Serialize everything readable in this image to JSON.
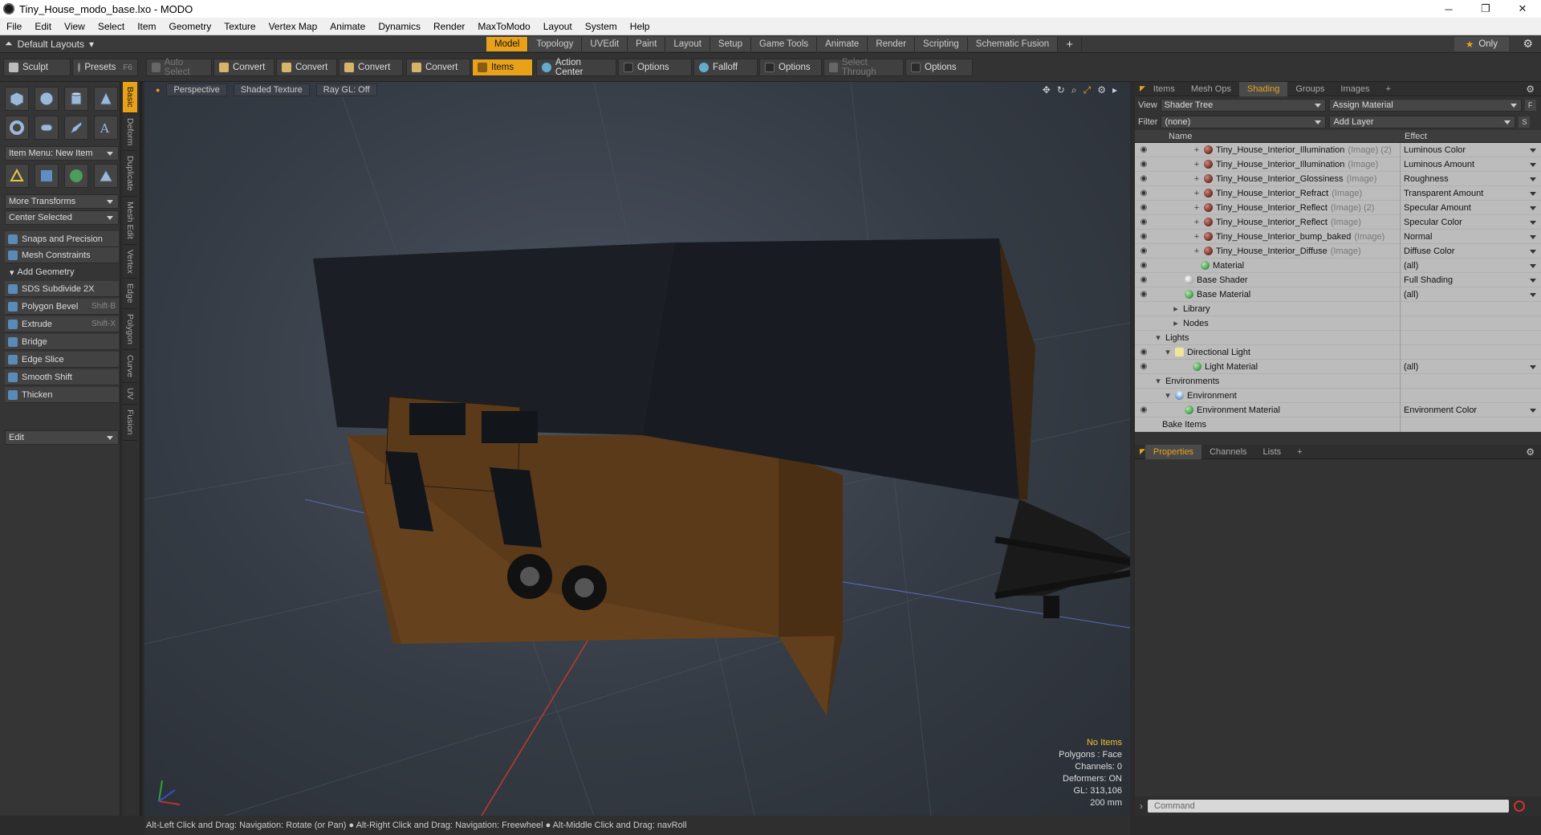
{
  "window": {
    "title": "Tiny_House_modo_base.lxo - MODO",
    "min": "─",
    "max": "❐",
    "close": "✕"
  },
  "menu": [
    "File",
    "Edit",
    "View",
    "Select",
    "Item",
    "Geometry",
    "Texture",
    "Vertex Map",
    "Animate",
    "Dynamics",
    "Render",
    "MaxToModo",
    "Layout",
    "System",
    "Help"
  ],
  "layouts": {
    "label": "Default Layouts"
  },
  "mode_tabs": [
    "Model",
    "Topology",
    "UVEdit",
    "Paint",
    "Layout",
    "Setup",
    "Game Tools",
    "Animate",
    "Render",
    "Scripting",
    "Schematic Fusion"
  ],
  "mode_active": "Model",
  "only_label": "Only",
  "toolbar": {
    "sculpt": "Sculpt",
    "presets": "Presets",
    "presets_key": "F6",
    "auto_select": "Auto Select",
    "convert1": "Convert",
    "convert2": "Convert",
    "convert3": "Convert",
    "convert4": "Convert",
    "items": "Items",
    "action_center": "Action Center",
    "options1": "Options",
    "falloff": "Falloff",
    "options2": "Options",
    "select_through": "Select Through",
    "options3": "Options"
  },
  "left": {
    "item_menu": "Item Menu: New Item",
    "more_transforms": "More Transforms",
    "center_selected": "Center Selected",
    "snaps": "Snaps and Precision",
    "mesh_constraints": "Mesh Constraints",
    "add_geometry": "Add Geometry",
    "tools": [
      {
        "label": "SDS Subdivide 2X",
        "key": ""
      },
      {
        "label": "Polygon Bevel",
        "key": "Shift-B"
      },
      {
        "label": "Extrude",
        "key": "Shift-X"
      },
      {
        "label": "Bridge",
        "key": ""
      },
      {
        "label": "Edge Slice",
        "key": ""
      },
      {
        "label": "Smooth Shift",
        "key": ""
      },
      {
        "label": "Thicken",
        "key": ""
      }
    ],
    "edit": "Edit"
  },
  "vtabs": [
    "Basic",
    "Deform",
    "Duplicate",
    "Mesh Edit",
    "Vertex",
    "Edge",
    "Polygon",
    "Curve",
    "UV",
    "Fusion"
  ],
  "viewport": {
    "perspective": "Perspective",
    "shaded": "Shaded Texture",
    "raygl": "Ray GL: Off",
    "stats": {
      "no_items": "No Items",
      "polygons": "Polygons : Face",
      "channels": "Channels: 0",
      "deformers": "Deformers: ON",
      "gl": "GL: 313,106",
      "size": "200 mm"
    }
  },
  "right": {
    "tabs": [
      "Items",
      "Mesh Ops",
      "Shading",
      "Groups",
      "Images"
    ],
    "active": "Shading",
    "view_label": "View",
    "view_value": "Shader Tree",
    "assign": "Assign Material",
    "filter_label": "Filter",
    "filter_value": "(none)",
    "add_layer": "Add Layer",
    "col_name": "Name",
    "col_effect": "Effect",
    "rows": [
      {
        "name": "Tiny_House_Interior_Illumination",
        "sub": "(Image) (2)",
        "effect": "Luminous Color",
        "kind": "img"
      },
      {
        "name": "Tiny_House_Interior_Illumination",
        "sub": "(Image)",
        "effect": "Luminous Amount",
        "kind": "img"
      },
      {
        "name": "Tiny_House_Interior_Glossiness",
        "sub": "(Image)",
        "effect": "Roughness",
        "kind": "img"
      },
      {
        "name": "Tiny_House_Interior_Refract",
        "sub": "(Image)",
        "effect": "Transparent Amount",
        "kind": "img"
      },
      {
        "name": "Tiny_House_Interior_Reflect",
        "sub": "(Image) (2)",
        "effect": "Specular Amount",
        "kind": "img"
      },
      {
        "name": "Tiny_House_Interior_Reflect",
        "sub": "(Image)",
        "effect": "Specular Color",
        "kind": "img"
      },
      {
        "name": "Tiny_House_Interior_bump_baked",
        "sub": "(Image)",
        "effect": "Normal",
        "kind": "img"
      },
      {
        "name": "Tiny_House_Interior_Diffuse",
        "sub": "(Image)",
        "effect": "Diffuse Color",
        "kind": "img"
      },
      {
        "name": "Material",
        "sub": "",
        "effect": "(all)",
        "kind": "mat"
      },
      {
        "name": "Base Shader",
        "sub": "",
        "effect": "Full Shading",
        "kind": "sh"
      },
      {
        "name": "Base Material",
        "sub": "",
        "effect": "(all)",
        "kind": "mat"
      },
      {
        "name": "Library",
        "sub": "",
        "effect": "",
        "kind": "folder"
      },
      {
        "name": "Nodes",
        "sub": "",
        "effect": "",
        "kind": "folder"
      },
      {
        "name": "Lights",
        "sub": "",
        "effect": "",
        "kind": "group"
      },
      {
        "name": "Directional Light",
        "sub": "",
        "effect": "",
        "kind": "light"
      },
      {
        "name": "Light Material",
        "sub": "",
        "effect": "(all)",
        "kind": "mat"
      },
      {
        "name": "Environments",
        "sub": "",
        "effect": "",
        "kind": "group"
      },
      {
        "name": "Environment",
        "sub": "",
        "effect": "",
        "kind": "env"
      },
      {
        "name": "Environment Material",
        "sub": "",
        "effect": "Environment Color",
        "kind": "mat"
      },
      {
        "name": "Bake Items",
        "sub": "",
        "effect": "",
        "kind": "group"
      }
    ],
    "props_tabs": [
      "Properties",
      "Channels",
      "Lists"
    ],
    "props_active": "Properties",
    "command_placeholder": "Command"
  },
  "status": "Alt-Left Click and Drag: Navigation: Rotate (or Pan) ● Alt-Right Click and Drag: Navigation: Freewheel ● Alt-Middle Click and Drag: navRoll"
}
